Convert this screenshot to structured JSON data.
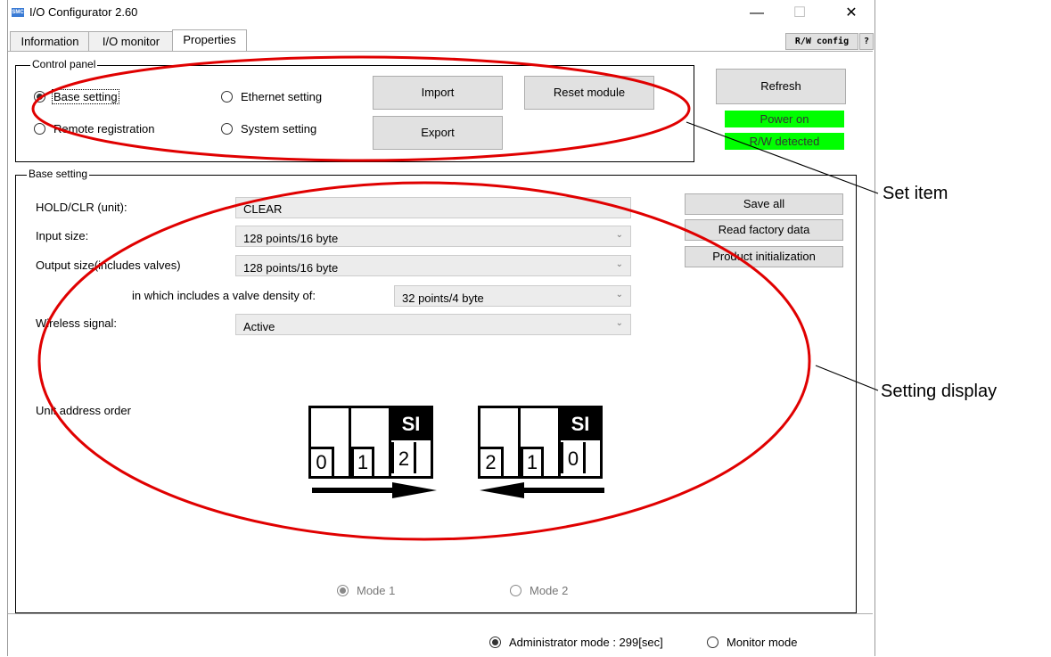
{
  "window": {
    "title": "I/O Configurator 2.60",
    "icon_label": "SMC",
    "minimize": "—",
    "maximize": "☐",
    "close": "✕"
  },
  "tabs": [
    {
      "label": "Information"
    },
    {
      "label": "I/O monitor"
    },
    {
      "label": "Properties"
    }
  ],
  "tab_buttons": {
    "rw_config": "R/W config",
    "help": "?"
  },
  "control_panel": {
    "title": "Control panel",
    "radios": [
      {
        "label": "Base setting",
        "checked": true
      },
      {
        "label": "Ethernet setting",
        "checked": false
      },
      {
        "label": "Remote registration",
        "checked": false
      },
      {
        "label": "System setting",
        "checked": false
      }
    ],
    "import_label": "Import",
    "export_label": "Export",
    "reset_label": "Reset module"
  },
  "right_panel": {
    "refresh_label": "Refresh",
    "power_status": "Power on",
    "rw_status": "R/W detected",
    "status_color": "#00ff00"
  },
  "base_setting": {
    "title": "Base setting",
    "hold_clr_label": "HOLD/CLR (unit):",
    "hold_clr_value": "CLEAR",
    "input_size_label": "Input size:",
    "input_size_value": "128 points/16 byte",
    "output_size_label": "Output size(includes valves)",
    "output_size_value": "128 points/16 byte",
    "valve_density_label": "in which includes a valve density of:",
    "valve_density_value": "32 points/4 byte",
    "wireless_label": "Wireless signal:",
    "wireless_value": "Active",
    "save_all_label": "Save all",
    "read_factory_label": "Read factory data",
    "product_init_label": "Product initialization",
    "unit_address_label": "Unit address order",
    "mode1": {
      "si": "SI",
      "nums": [
        "0",
        "1",
        "2"
      ]
    },
    "mode2": {
      "si": "SI",
      "nums": [
        "2",
        "1",
        "0"
      ]
    },
    "mode1_label": "Mode 1",
    "mode2_label": "Mode 2"
  },
  "status_bar": {
    "admin_label": "Administrator mode : 299[sec]",
    "monitor_label": "Monitor mode"
  },
  "annotations": {
    "set_item": "Set item",
    "setting_display": "Setting display",
    "color": "#e00000"
  }
}
